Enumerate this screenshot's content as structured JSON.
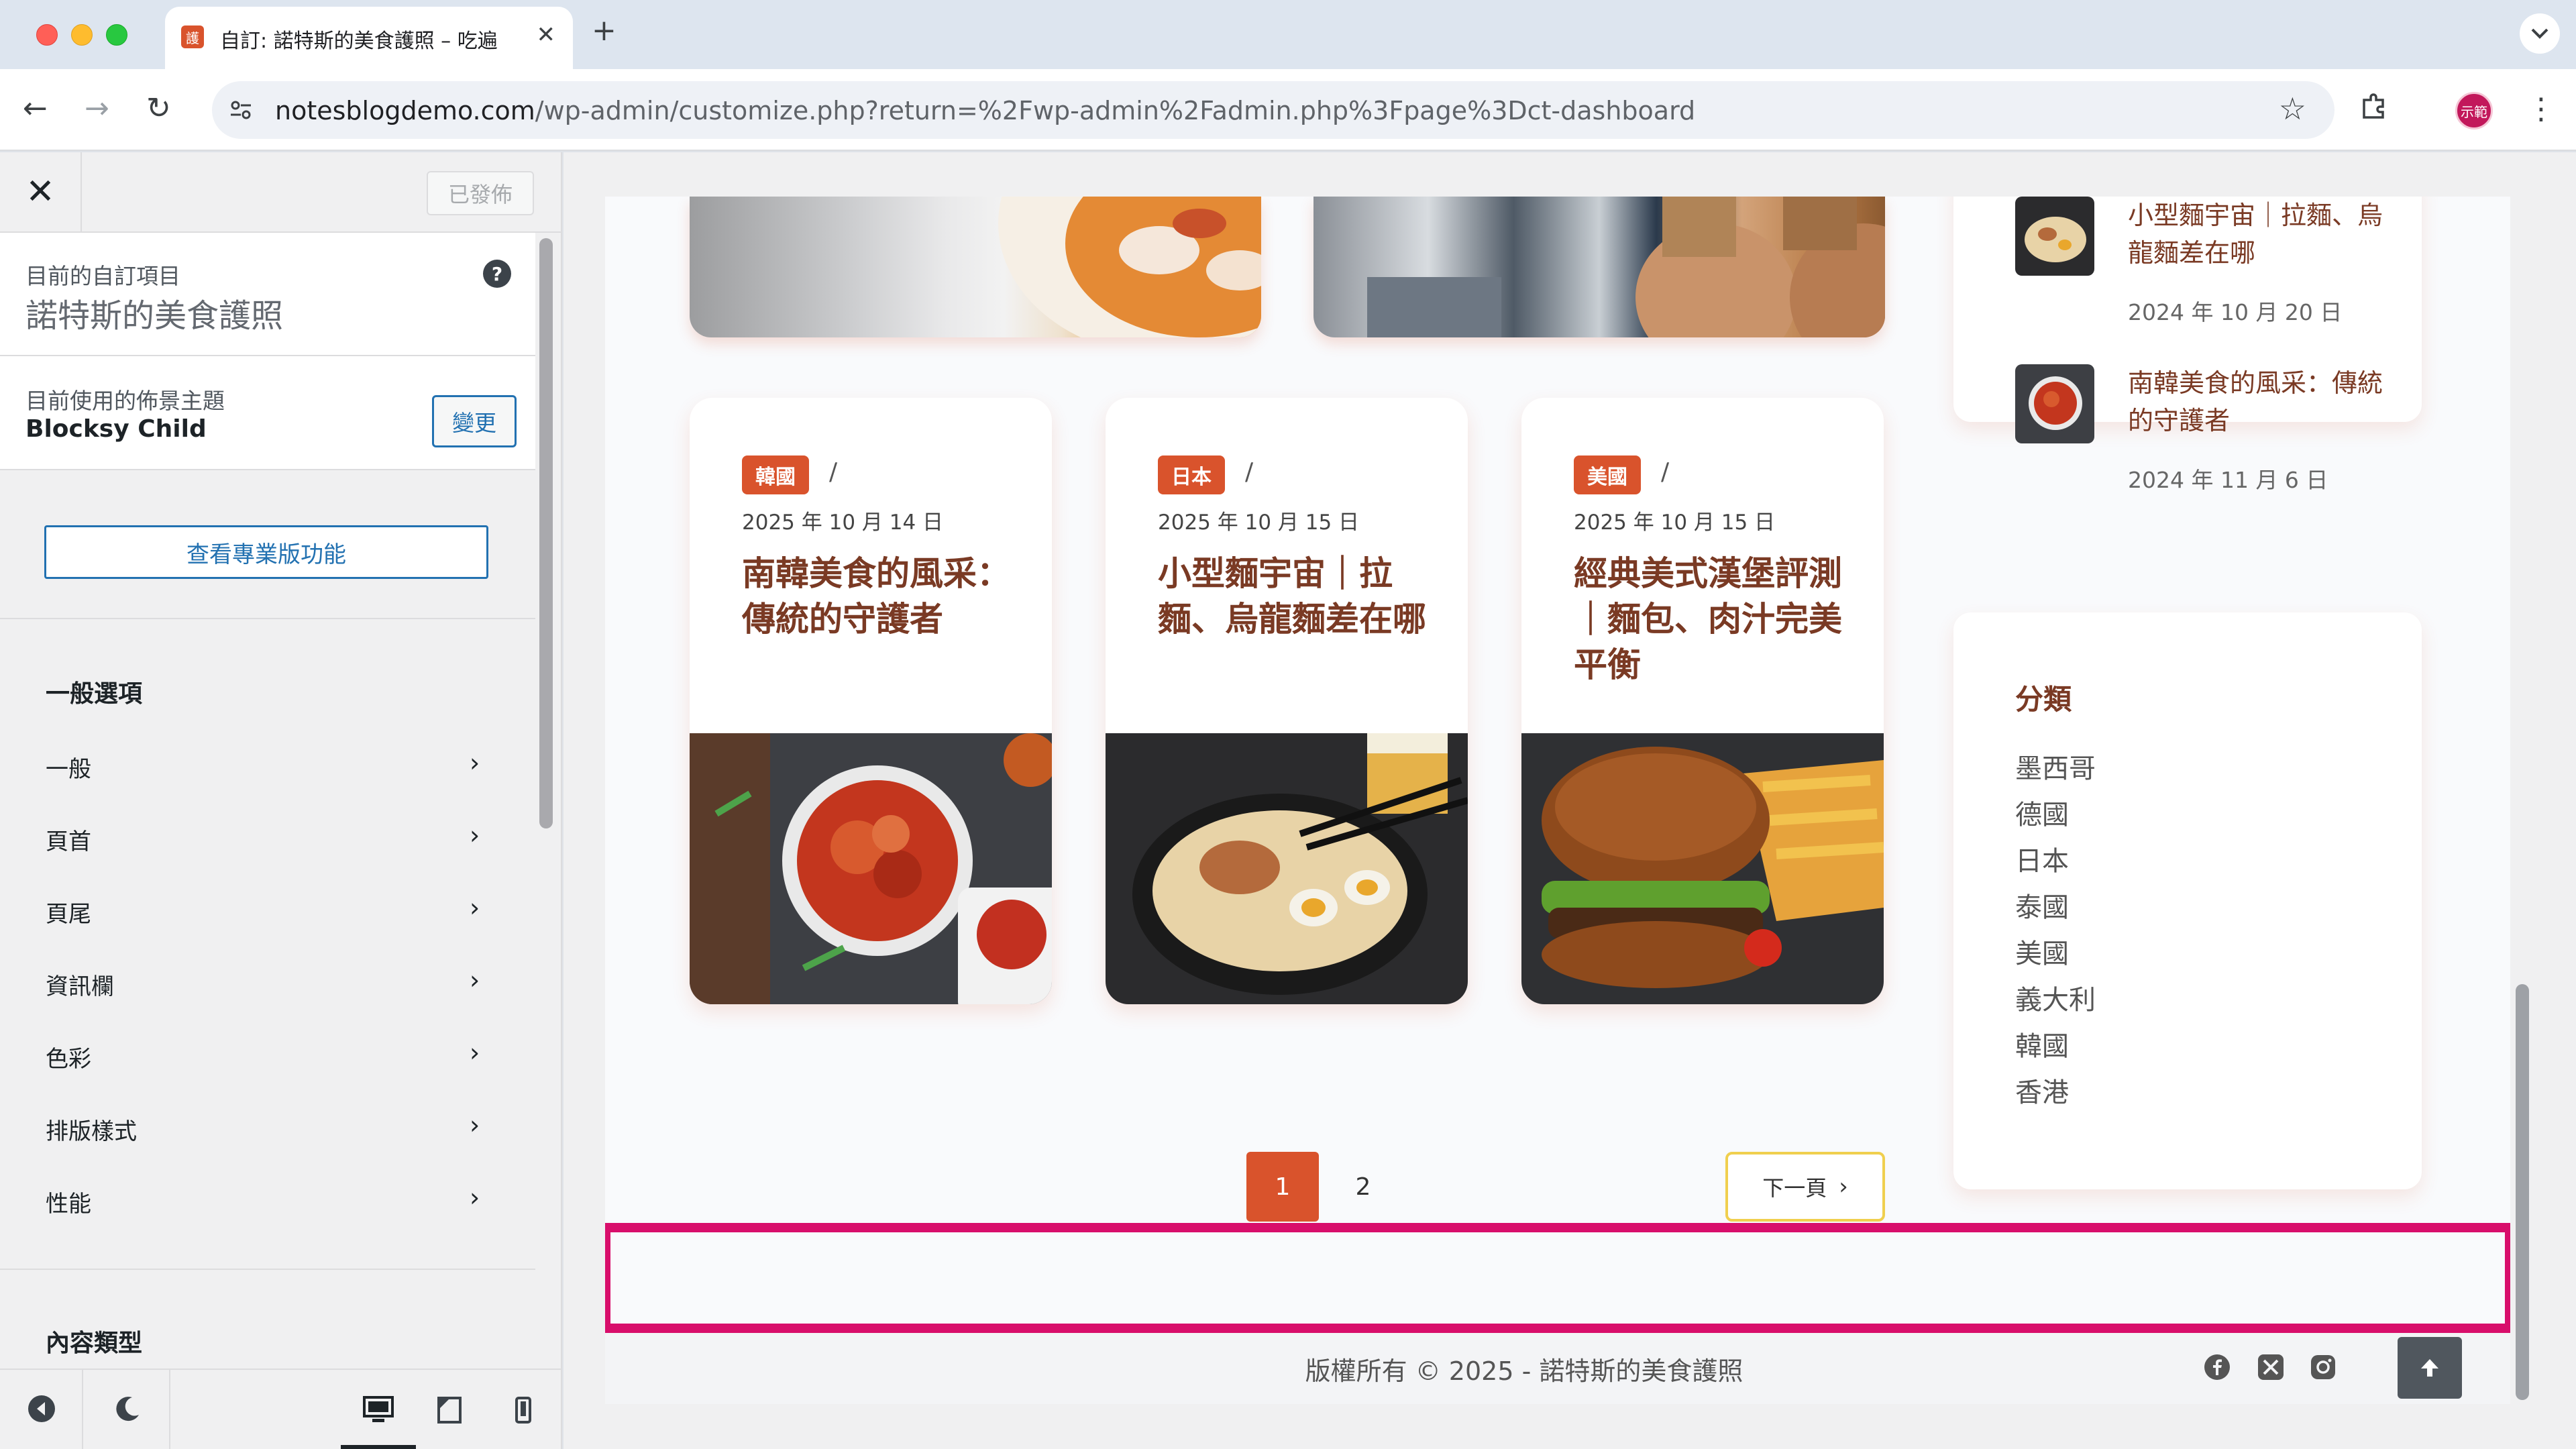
{
  "browser": {
    "tab_title": "自訂: 諾特斯的美食護照 – 吃遍",
    "tab_favicon": "護",
    "url_host": "notesblogdemo.com",
    "url_path": "/wp-admin/customize.php?return=%2Fwp-admin%2Fadmin.php%3Fpage%3Dct-dashboard",
    "profile_label": "示範"
  },
  "customizer": {
    "published_label": "已發佈",
    "current_label": "目前的自訂項目",
    "current_value": "諾特斯的美食護照",
    "theme_label": "目前使用的佈景主題",
    "theme_name": "Blocksy Child",
    "change_label": "變更",
    "pro_label": "查看專業版功能",
    "general_section": "一般選項",
    "items": [
      {
        "label": "一般"
      },
      {
        "label": "頁首"
      },
      {
        "label": "頁尾"
      },
      {
        "label": "資訊欄"
      },
      {
        "label": "色彩"
      },
      {
        "label": "排版樣式"
      },
      {
        "label": "性能"
      }
    ],
    "content_section": "內容類型"
  },
  "posts": [
    {
      "category": "韓國",
      "date": "2025 年 10 月 14 日",
      "title": "南韓美食的風采：傳統的守護者"
    },
    {
      "category": "日本",
      "date": "2025 年 10 月 15 日",
      "title": "小型麵宇宙｜拉麵、烏龍麵差在哪"
    },
    {
      "category": "美國",
      "date": "2025 年 10 月 15 日",
      "title": "經典美式漢堡評測｜麵包、肉汁完美平衡"
    }
  ],
  "pagination": {
    "current": "1",
    "page2": "2",
    "next": "下一頁"
  },
  "recent": [
    {
      "title": "小型麵宇宙｜拉麵、烏龍麵差在哪",
      "date": "2024 年 10 月 20 日"
    },
    {
      "title": "南韓美食的風采：傳統的守護者",
      "date": "2024 年 11 月 6 日"
    }
  ],
  "categories_widget": {
    "title": "分類",
    "items": [
      "墨西哥",
      "德國",
      "日本",
      "泰國",
      "美國",
      "義大利",
      "韓國",
      "香港"
    ]
  },
  "footer": {
    "copyright": "版權所有 © 2025 - 諾特斯的美食護照"
  },
  "colors": {
    "accent": "#d9532c",
    "highlight": "#d80e6b",
    "wp_blue": "#2271b1"
  }
}
